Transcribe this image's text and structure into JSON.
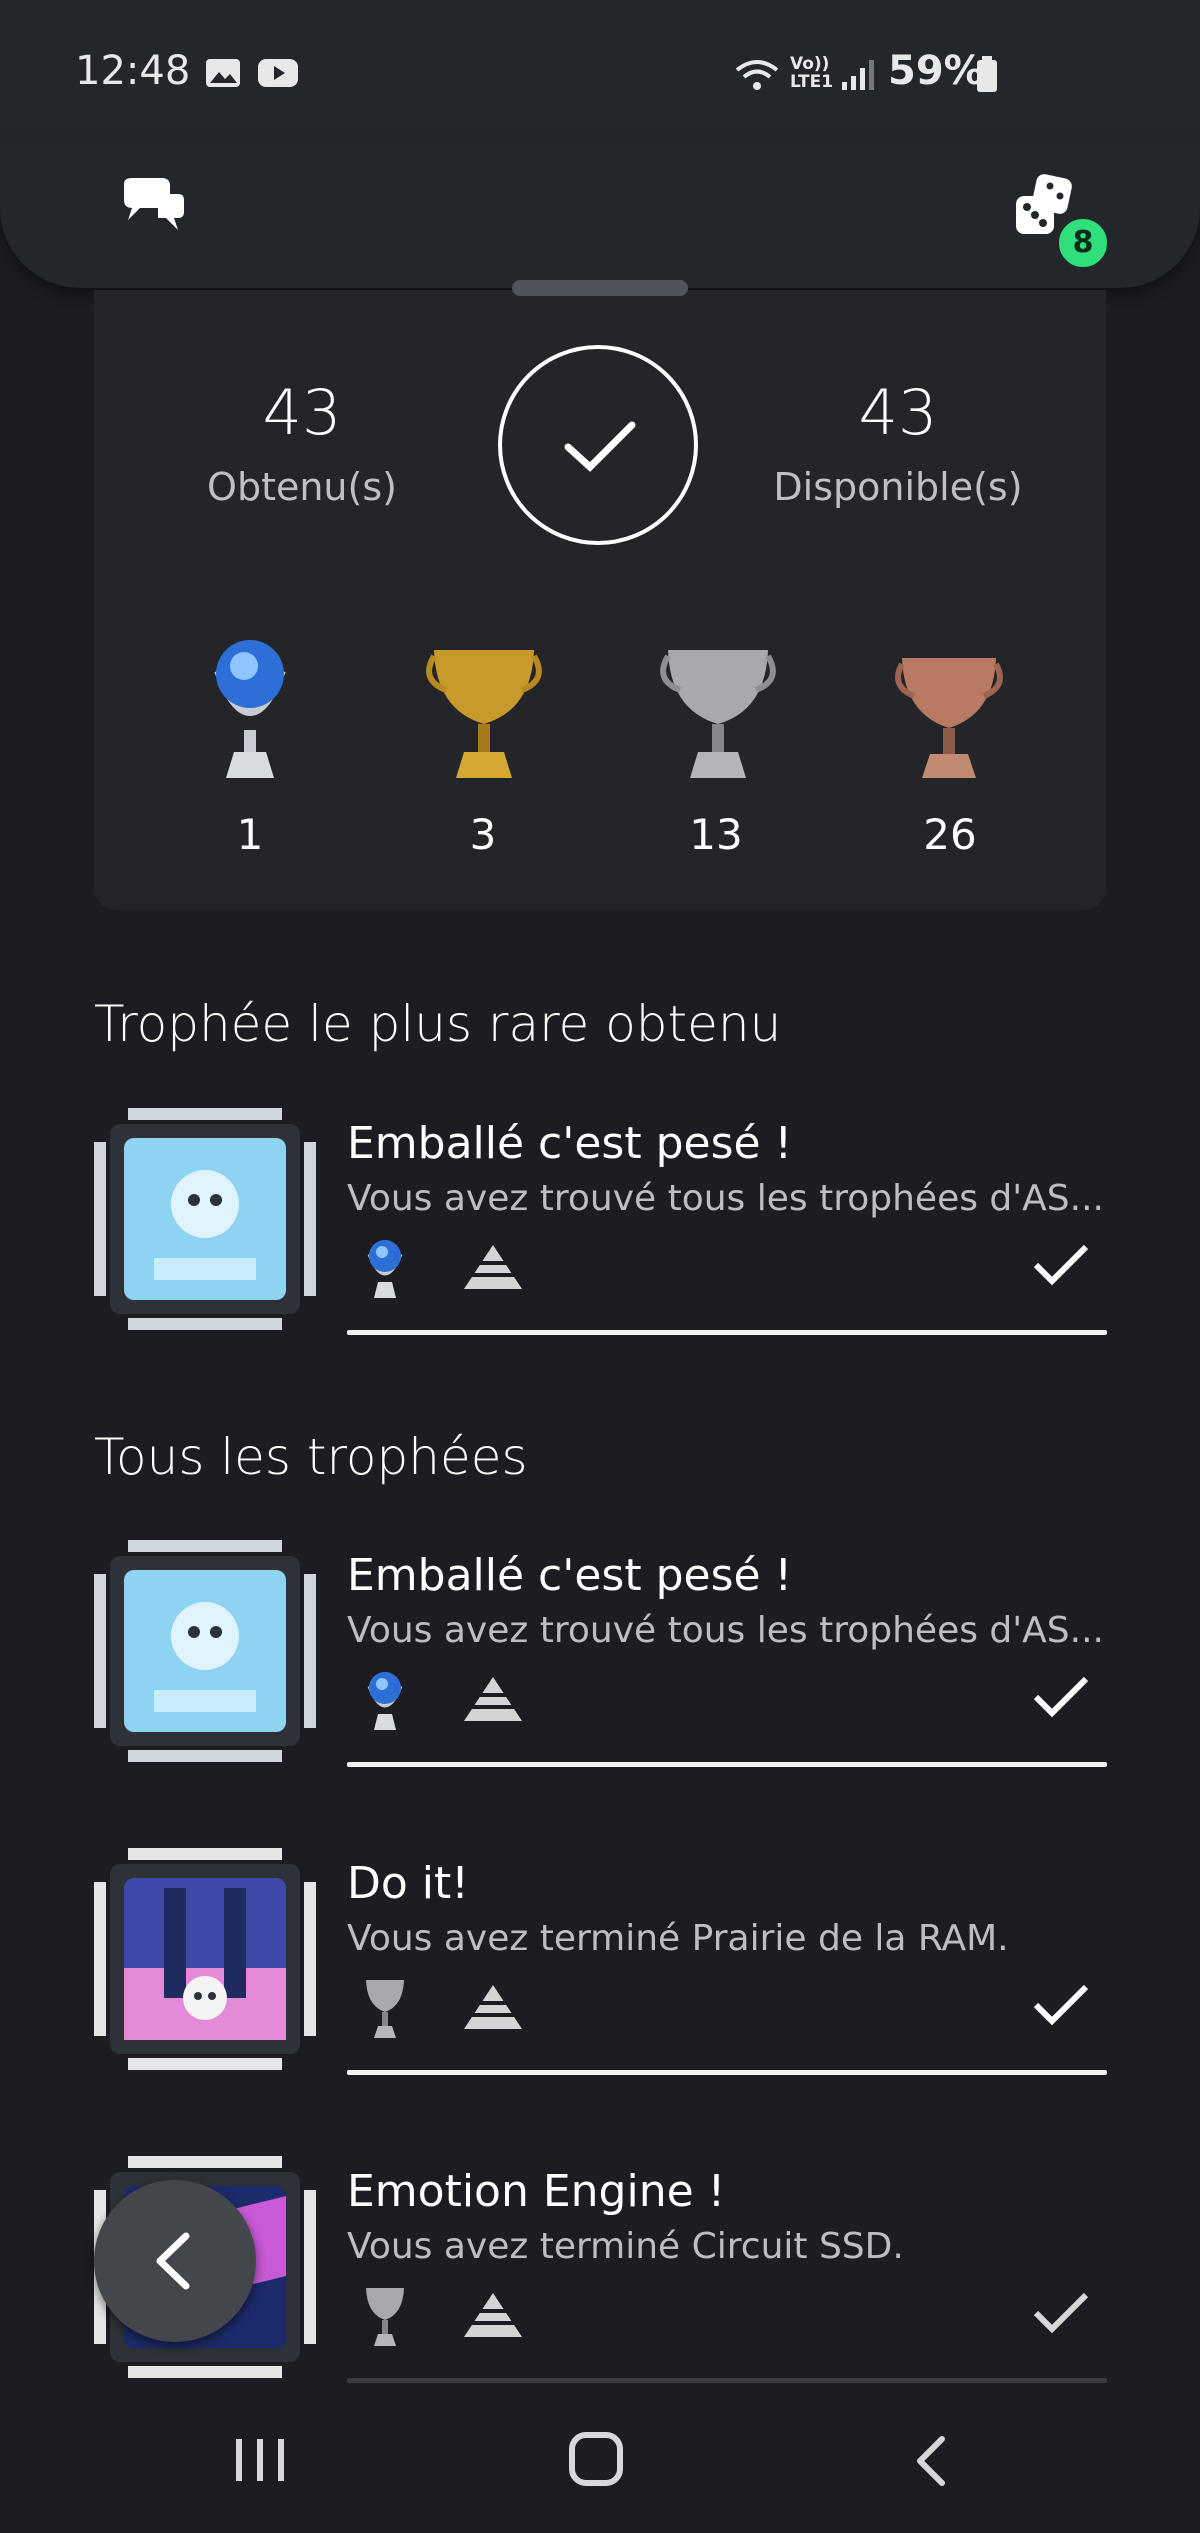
{
  "status_bar": {
    "time": "12:48",
    "battery": "59%",
    "network": "Vo)) LTE1"
  },
  "summary": {
    "earned_count": "43",
    "earned_label": "Obtenu(s)",
    "available_count": "43",
    "available_label": "Disponible(s)",
    "trophies": [
      {
        "grade": "platinum",
        "count": "1"
      },
      {
        "grade": "gold",
        "count": "3"
      },
      {
        "grade": "silver",
        "count": "13"
      },
      {
        "grade": "bronze",
        "count": "26"
      }
    ]
  },
  "rarest": {
    "heading": "Trophée le plus rare obtenu",
    "item": {
      "title": "Emballé c'est pesé !",
      "description": "Vous avez trouvé tous les trophées d'AS...",
      "grade": "platinum"
    }
  },
  "all": {
    "heading": "Tous les trophées",
    "items": [
      {
        "title": "Emballé c'est pesé !",
        "description": "Vous avez trouvé tous les trophées d'AS...",
        "grade": "platinum"
      },
      {
        "title": "Do it!",
        "description": "Vous avez terminé Prairie de la RAM.",
        "grade": "silver"
      },
      {
        "title": "Emotion Engine !",
        "description": "Vous avez terminé Circuit SSD.",
        "grade": "silver"
      }
    ]
  },
  "header": {
    "notification_badge": "8"
  },
  "colors": {
    "background": "#1d1c22",
    "panel": "#242529",
    "badge": "#2fe07a",
    "platinum": "#6fb6ff",
    "gold": "#c89a2b",
    "silver": "#a7a9ad",
    "bronze": "#b87a63"
  }
}
